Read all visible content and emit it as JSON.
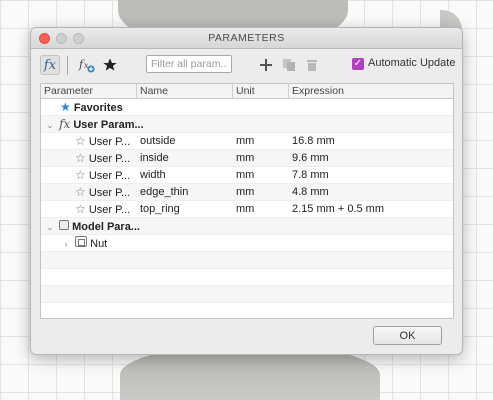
{
  "window": {
    "title": "PARAMETERS"
  },
  "toolbar": {
    "fx_label": "fx",
    "filter_placeholder": "Filter all param...",
    "auto_update_label": "Automatic Update",
    "auto_update_checked": true
  },
  "table": {
    "columns": [
      "Parameter",
      "Name",
      "Unit",
      "Expression"
    ],
    "groups": {
      "favorites": "Favorites",
      "user_params": "User Param...",
      "model_params": "Model Para...",
      "nut": "Nut"
    },
    "user_rows": [
      {
        "parameter": "User P...",
        "name": "outside",
        "unit": "mm",
        "expression": "16.8 mm"
      },
      {
        "parameter": "User P...",
        "name": "inside",
        "unit": "mm",
        "expression": "9.6 mm"
      },
      {
        "parameter": "User P...",
        "name": "width",
        "unit": "mm",
        "expression": "7.8 mm"
      },
      {
        "parameter": "User P...",
        "name": "edge_thin",
        "unit": "mm",
        "expression": "4.8 mm"
      },
      {
        "parameter": "User P...",
        "name": "top_ring",
        "unit": "mm",
        "expression": "2.15 mm + 0.5 mm"
      }
    ]
  },
  "footer": {
    "ok_label": "OK"
  },
  "colors": {
    "accent_star": "#2b86d6",
    "checkbox": "#b23ec2",
    "close": "#fc5f57"
  }
}
